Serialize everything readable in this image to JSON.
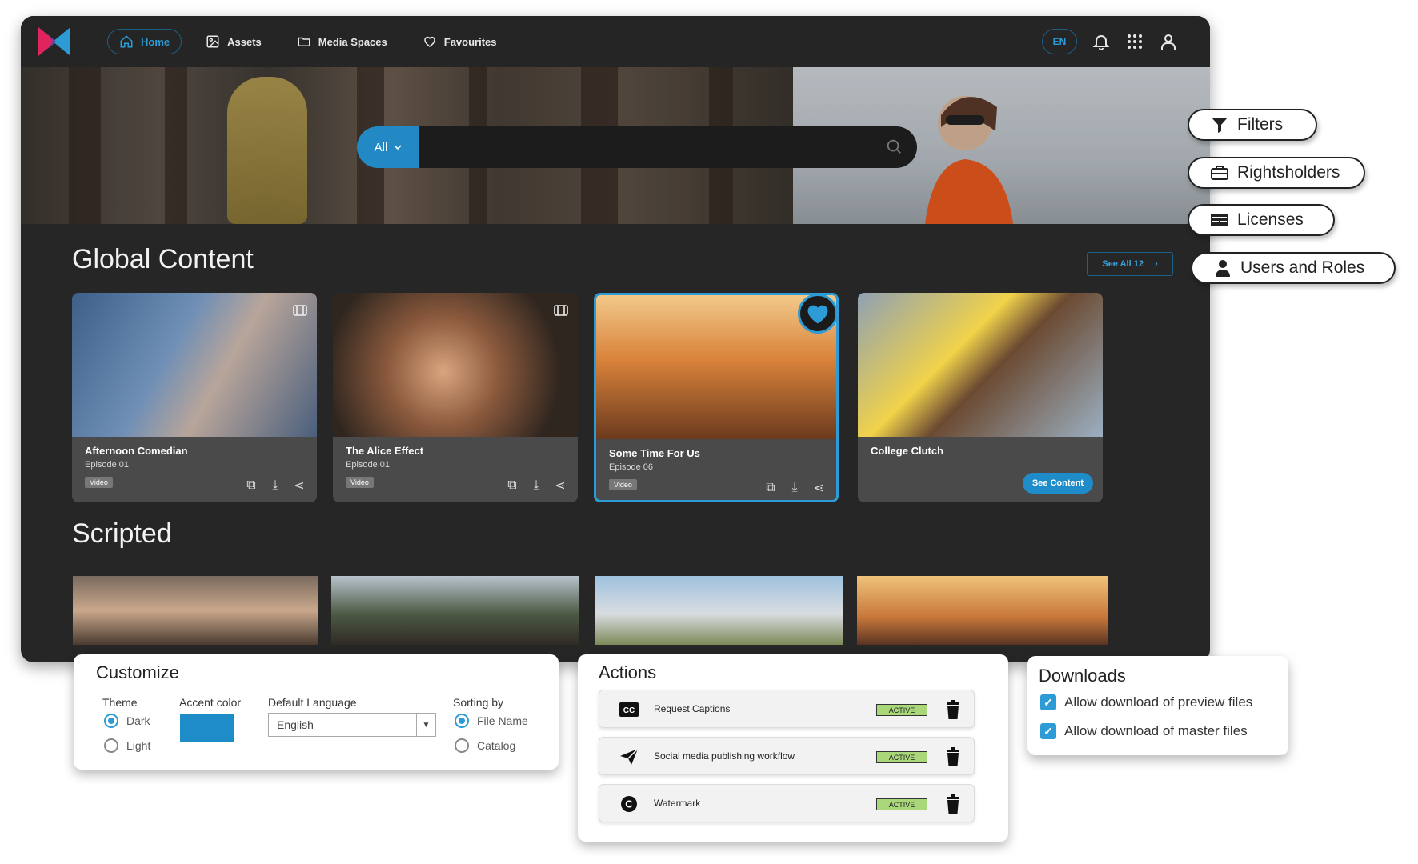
{
  "nav": {
    "items": [
      {
        "label": "Home",
        "icon": "home-icon"
      },
      {
        "label": "Assets",
        "icon": "image-icon"
      },
      {
        "label": "Media Spaces",
        "icon": "folder-icon"
      },
      {
        "label": "Favourites",
        "icon": "heart-icon"
      }
    ],
    "language": "EN"
  },
  "search": {
    "scope": "All",
    "placeholder": ""
  },
  "global": {
    "title": "Global Content",
    "see_all": "See All 12",
    "cards": [
      {
        "title": "Afternoon Comedian",
        "episode": "Episode 01",
        "type": "Video"
      },
      {
        "title": "The Alice Effect",
        "episode": "Episode 01",
        "type": "Video"
      },
      {
        "title": "Some Time For Us",
        "episode": "Episode 06",
        "type": "Video"
      },
      {
        "title": "College Clutch",
        "button": "See Content"
      }
    ]
  },
  "scripted": {
    "title": "Scripted"
  },
  "pills": {
    "filters": "Filters",
    "rightsholders": "Rightsholders",
    "licenses": "Licenses",
    "users_roles": "Users and Roles"
  },
  "customize": {
    "title": "Customize",
    "theme_label": "Theme",
    "theme_dark": "Dark",
    "theme_light": "Light",
    "accent_label": "Accent color",
    "language_label": "Default Language",
    "language_value": "English",
    "sorting_label": "Sorting by",
    "sort_file": "File Name",
    "sort_catalog": "Catalog"
  },
  "actions": {
    "title": "Actions",
    "rows": [
      {
        "name": "Request Captions",
        "status": "ACTIVE"
      },
      {
        "name": "Social media publishing workflow",
        "status": "ACTIVE"
      },
      {
        "name": "Watermark",
        "status": "ACTIVE"
      }
    ]
  },
  "downloads": {
    "title": "Downloads",
    "preview": "Allow download of preview files",
    "master": "Allow download of master files"
  },
  "colors": {
    "accent": "#2d9bd6",
    "app_bg": "#262626",
    "status_active": "#a9d77a"
  }
}
